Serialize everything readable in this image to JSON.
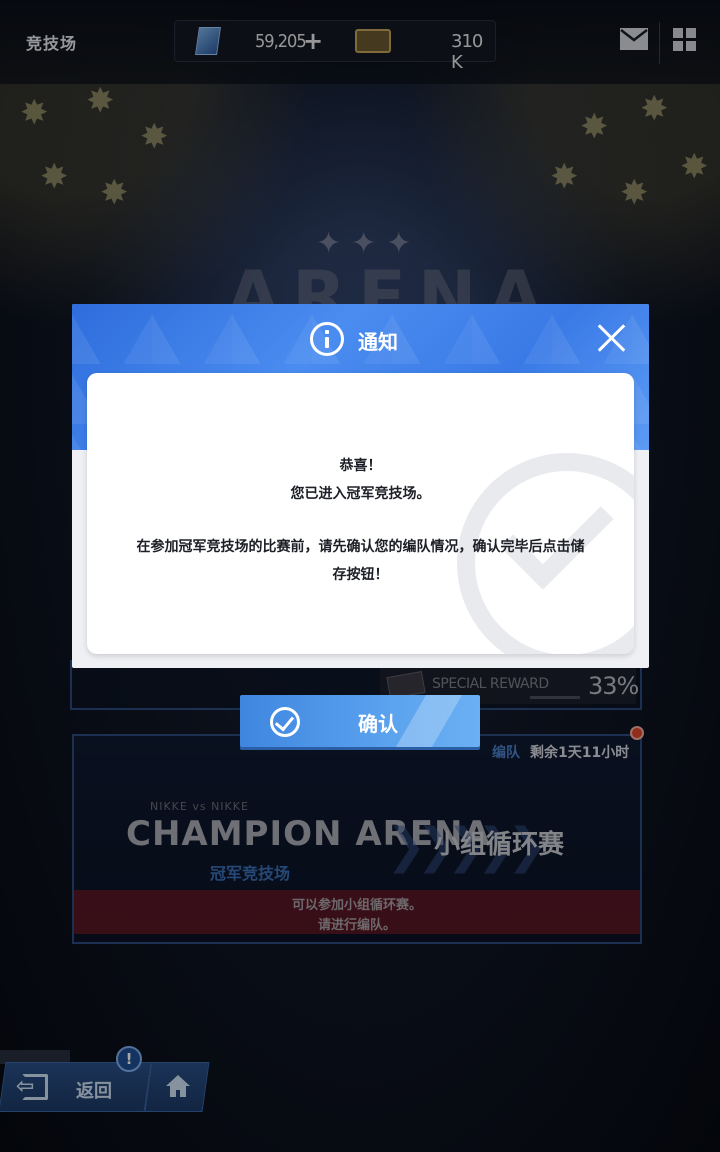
{
  "top_bar": {
    "title": "竞技场",
    "gems": "59,205",
    "plus": "+",
    "tickets": "310 K"
  },
  "background": {
    "arena_logo": "ARENA",
    "special_reward": {
      "label": "SPECIAL REWARD",
      "percent": "33%"
    },
    "champion_panel": {
      "team_label": "编队",
      "time_left": "剩余1天11小时",
      "subtitle": "NIKKE vs NIKKE",
      "title": "CHAMPION ARENA",
      "title_cn": "冠军竞技场",
      "mode": "小组循环赛",
      "warning_line1": "可以参加小组循环赛。",
      "warning_line2": "请进行编队。"
    }
  },
  "dialog": {
    "title": "通知",
    "lines": [
      "恭喜！",
      "您已进入冠军竞技场。",
      "在参加冠军竞技场的比赛前，请先确认您的编队情况，确认完毕后点击储",
      "存按钮！"
    ],
    "confirm_label": "确认"
  },
  "bottom_nav": {
    "back_label": "返回",
    "badge": "!"
  },
  "colors": {
    "dialog_header": "#3a7ae6",
    "confirm_button": "#5aa2ee",
    "background": "#101726"
  },
  "icons": [
    "gem-icon",
    "ticket-icon",
    "mail-icon",
    "grid-menu-icon",
    "info-icon",
    "close-icon",
    "check-icon",
    "back-icon",
    "home-icon"
  ]
}
